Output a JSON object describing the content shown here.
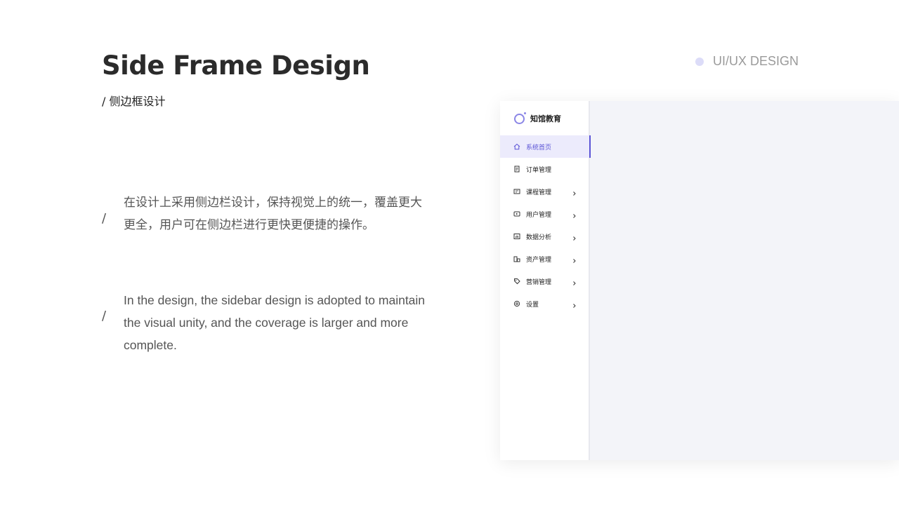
{
  "heading": {
    "title": "Side Frame Design",
    "subtitle": "/ 侧边框设计"
  },
  "tag": {
    "label": "UI/UX DESIGN",
    "dot_color": "#dcdcf8"
  },
  "paragraphs": {
    "cn": {
      "marker": "/",
      "text": "在设计上采用侧边栏设计，保持视觉上的统一，覆盖更大更全，用户可在侧边栏进行更快更便捷的操作。"
    },
    "en": {
      "marker": "/",
      "text": "In the design, the sidebar design is adopted to maintain the visual unity, and the coverage is larger and more complete."
    }
  },
  "mockup": {
    "brand": {
      "name": "知馆教育",
      "logo_icon": "ring-logo-icon",
      "accent": "#8b86e6"
    },
    "active_color": "#5a53d6",
    "menu": [
      {
        "label": "系统首页",
        "icon": "home-icon",
        "active": true,
        "has_children": false
      },
      {
        "label": "订单管理",
        "icon": "document-icon",
        "active": false,
        "has_children": false
      },
      {
        "label": "课程管理",
        "icon": "course-icon",
        "active": false,
        "has_children": true
      },
      {
        "label": "用户管理",
        "icon": "play-icon",
        "active": false,
        "has_children": true
      },
      {
        "label": "数据分析",
        "icon": "chart-icon",
        "active": false,
        "has_children": true
      },
      {
        "label": "资产管理",
        "icon": "asset-icon",
        "active": false,
        "has_children": true
      },
      {
        "label": "营销管理",
        "icon": "tag-icon",
        "active": false,
        "has_children": true
      },
      {
        "label": "设置",
        "icon": "gear-icon",
        "active": false,
        "has_children": true
      }
    ]
  }
}
